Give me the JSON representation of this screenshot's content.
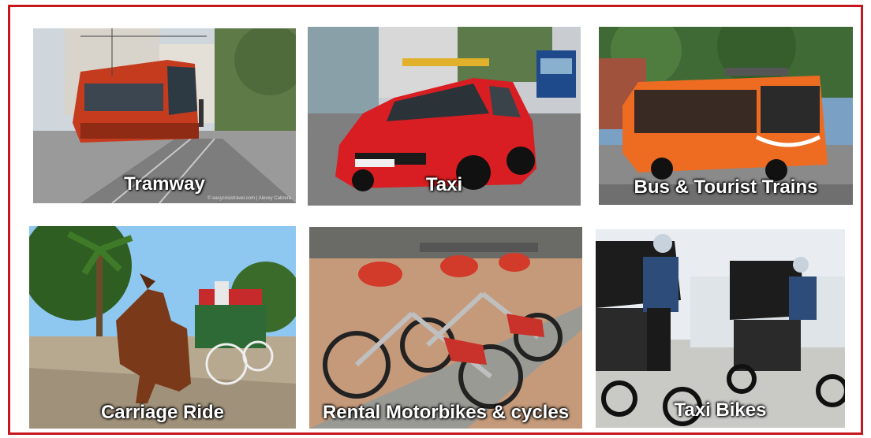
{
  "accent_color": "#c8161d",
  "tiles": [
    {
      "label": "Tramway",
      "icon": "tram-photo"
    },
    {
      "label": "Taxi",
      "icon": "taxi-photo"
    },
    {
      "label": "Bus & Tourist Trains",
      "icon": "bus-photo"
    },
    {
      "label": "Carriage Ride",
      "icon": "horse-carriage-photo"
    },
    {
      "label": "Rental Motorbikes & cycles",
      "icon": "bike-rental-photo"
    },
    {
      "label": "Taxi Bikes",
      "icon": "pedicab-photo"
    }
  ],
  "watermark": "© easycrisis­travel.com | Alexey Cabrera"
}
